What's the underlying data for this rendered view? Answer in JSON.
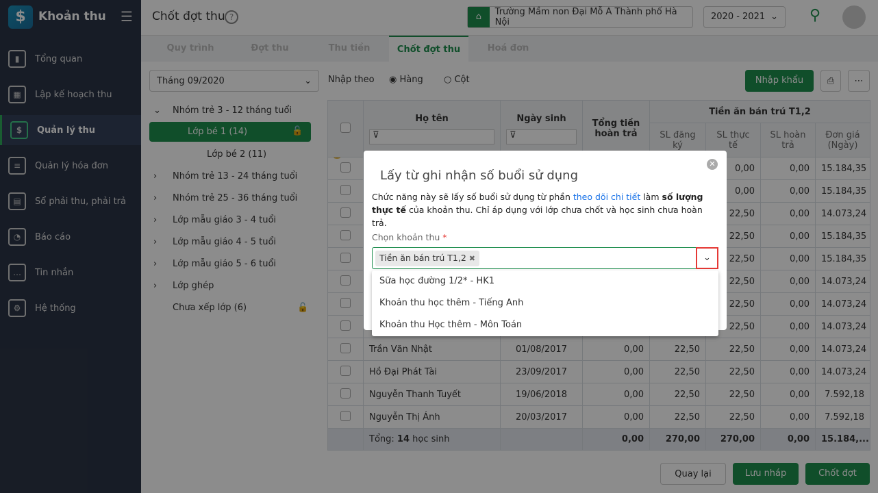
{
  "app": {
    "title": "Khoản thu",
    "logo": "$"
  },
  "sidebar": {
    "items": [
      {
        "label": "Tổng quan",
        "icon": "chart-icon"
      },
      {
        "label": "Lập kế hoạch thu",
        "icon": "calendar-icon"
      },
      {
        "label": "Quản lý thu",
        "icon": "money-hand-icon"
      },
      {
        "label": "Quản lý hóa đơn",
        "icon": "invoice-icon"
      },
      {
        "label": "Sổ phải thu, phải trả",
        "icon": "book-icon"
      },
      {
        "label": "Báo cáo",
        "icon": "pie-icon"
      },
      {
        "label": "Tin nhắn",
        "icon": "chat-icon"
      },
      {
        "label": "Hệ thống",
        "icon": "gear-icon"
      }
    ]
  },
  "header": {
    "title": "Chốt đợt thu",
    "school": "Trường Mầm non Đại Mỗ A Thành phố Hà Nội",
    "year": "2020 - 2021"
  },
  "tabs": [
    "Quy trình",
    "Đợt thu",
    "Thu tiền",
    "Chốt đợt thu",
    "Hoá đơn"
  ],
  "toolbar": {
    "month": "Tháng 09/2020",
    "import_by": "Nhập theo",
    "opt_row": "Hàng",
    "opt_col": "Cột",
    "import": "Nhập khẩu"
  },
  "tree": [
    "Nhóm trẻ 3 - 12 tháng tuổi",
    "Lớp bé 1 (14)",
    "Lớp bé 2 (11)",
    "Nhóm trẻ 13 - 24 tháng tuổi",
    "Nhóm trẻ 25 - 36 tháng tuổi",
    "Lớp mẫu giáo 3 - 4 tuổi",
    "Lớp mẫu giáo 4 - 5 tuổi",
    "Lớp mẫu giáo 5 - 6 tuổi",
    "Lớp ghép",
    "Chưa xếp lớp (6)"
  ],
  "table": {
    "headers": {
      "name": "Họ tên",
      "dob": "Ngày sinh",
      "refund": "Tổng tiền hoàn trả",
      "group": "Tiền ăn bán trú T1,2",
      "reg": "SL đăng ký",
      "actual": "SL thực tế",
      "ret": "SL hoàn trả",
      "price": "Đơn giá (Ngày)"
    },
    "rows": [
      {
        "name": "",
        "dob": "",
        "refund": "",
        "reg": "",
        "actual": "0,00",
        "ret": "0,00",
        "price": "15.184,35"
      },
      {
        "name": "",
        "dob": "",
        "refund": "",
        "reg": "",
        "actual": "0,00",
        "ret": "0,00",
        "price": "15.184,35"
      },
      {
        "name": "",
        "dob": "",
        "refund": "",
        "reg": "",
        "actual": "22,50",
        "ret": "0,00",
        "price": "14.073,24"
      },
      {
        "name": "",
        "dob": "",
        "refund": "",
        "reg": "",
        "actual": "22,50",
        "ret": "0,00",
        "price": "15.184,35"
      },
      {
        "name": "",
        "dob": "",
        "refund": "",
        "reg": "",
        "actual": "22,50",
        "ret": "0,00",
        "price": "15.184,35"
      },
      {
        "name": "",
        "dob": "",
        "refund": "",
        "reg": "",
        "actual": "22,50",
        "ret": "0,00",
        "price": "14.073,24"
      },
      {
        "name": "",
        "dob": "",
        "refund": "",
        "reg": "",
        "actual": "22,50",
        "ret": "0,00",
        "price": "14.073,24"
      },
      {
        "name": "",
        "dob": "",
        "refund": "",
        "reg": "",
        "actual": "22,50",
        "ret": "0,00",
        "price": "14.073,24"
      },
      {
        "name": "Trần Văn Nhật",
        "dob": "01/08/2017",
        "refund": "0,00",
        "reg": "22,50",
        "actual": "22,50",
        "ret": "0,00",
        "price": "14.073,24"
      },
      {
        "name": "Hồ Đại Phát Tài",
        "dob": "23/09/2017",
        "refund": "0,00",
        "reg": "22,50",
        "actual": "22,50",
        "ret": "0,00",
        "price": "14.073,24"
      },
      {
        "name": "Nguyễn Thanh Tuyết",
        "dob": "19/06/2018",
        "refund": "0,00",
        "reg": "22,50",
        "actual": "22,50",
        "ret": "0,00",
        "price": "7.592,18"
      },
      {
        "name": "Nguyễn Thị Ánh",
        "dob": "20/03/2017",
        "refund": "0,00",
        "reg": "22,50",
        "actual": "22,50",
        "ret": "0,00",
        "price": "7.592,18"
      }
    ],
    "footer": {
      "label": "Tổng:",
      "count": "14",
      "suffix": "học sinh",
      "refund": "0,00",
      "reg": "270,00",
      "actual": "270,00",
      "ret": "0,00",
      "price": "15.184,..."
    }
  },
  "actions": {
    "back": "Quay lại",
    "draft": "Lưu nháp",
    "close": "Chốt đợt"
  },
  "modal": {
    "title": "Lấy từ ghi nhận số buổi sử dụng",
    "desc1": "Chức năng này sẽ lấy số buổi sử dụng từ phần ",
    "link": "theo dõi chi tiết",
    "desc2": " làm ",
    "bold": "số lượng thực tế",
    "desc3": " của khoản thu. Chỉ áp dụng với lớp chưa chốt và học sinh chưa hoàn trả.",
    "label": "Chọn khoản thu",
    "required": "*",
    "chip": "Tiền ăn bán trú T1,2",
    "options": [
      "Sữa học đường 1/2* - HK1",
      "Khoản thu học thêm - Tiếng Anh",
      "Khoản thu Học thêm - Môn Toán"
    ]
  }
}
